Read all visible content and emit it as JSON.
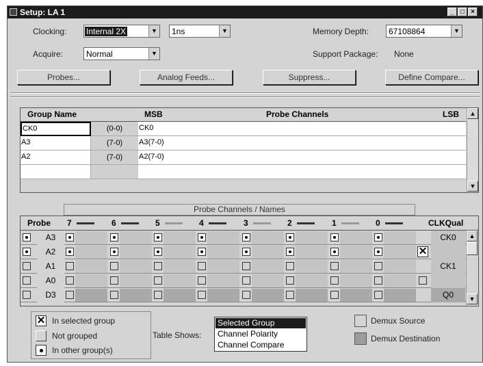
{
  "window": {
    "title": "Setup: LA 1"
  },
  "controls": {
    "clocking_label": "Clocking:",
    "clocking_value": "Internal 2X",
    "clock_period_value": "1ns",
    "memory_depth_label": "Memory Depth:",
    "memory_depth_value": "67108864",
    "acquire_label": "Acquire:",
    "acquire_value": "Normal",
    "support_package_label": "Support Package:",
    "support_package_value": "None"
  },
  "buttons": {
    "probes": "Probes...",
    "analog_feeds": "Analog Feeds...",
    "suppress": "Suppress...",
    "define_compare": "Define Compare..."
  },
  "group_table": {
    "headers": {
      "group_name": "Group Name",
      "msb": "MSB",
      "probe_channels": "Probe Channels",
      "lsb": "LSB"
    },
    "rows": [
      {
        "name": "CK0",
        "range": "(0-0)",
        "channels": "CK0"
      },
      {
        "name": "A3",
        "range": "(7-0)",
        "channels": "A3(7-0)"
      },
      {
        "name": "A2",
        "range": "(7-0)",
        "channels": "A2(7-0)"
      }
    ]
  },
  "probe_table": {
    "section_title": "Probe Channels / Names",
    "probe_header": "Probe",
    "clkqual_header": "CLKQual",
    "channels": [
      "7",
      "6",
      "5",
      "4",
      "3",
      "2",
      "1",
      "0"
    ],
    "rows": [
      {
        "name": "A3",
        "qual": "CK0"
      },
      {
        "name": "A2",
        "qual": ""
      },
      {
        "name": "A1",
        "qual": "CK1"
      },
      {
        "name": "A0",
        "qual": ""
      },
      {
        "name": "D3",
        "qual": "Q0"
      }
    ]
  },
  "legend": {
    "selected": "In selected group",
    "not_grouped": "Not grouped",
    "other": "In other group(s)"
  },
  "table_shows": {
    "label": "Table Shows:",
    "options": [
      "Selected Group",
      "Channel Polarity",
      "Channel Compare"
    ],
    "selected_index": 0
  },
  "demux": {
    "source": "Demux Source",
    "destination": "Demux Destination"
  },
  "colors": {
    "title_bar": "#1c1c1c",
    "window_bg": "#d4d4d4",
    "dark_group": "#a9a9a9"
  }
}
